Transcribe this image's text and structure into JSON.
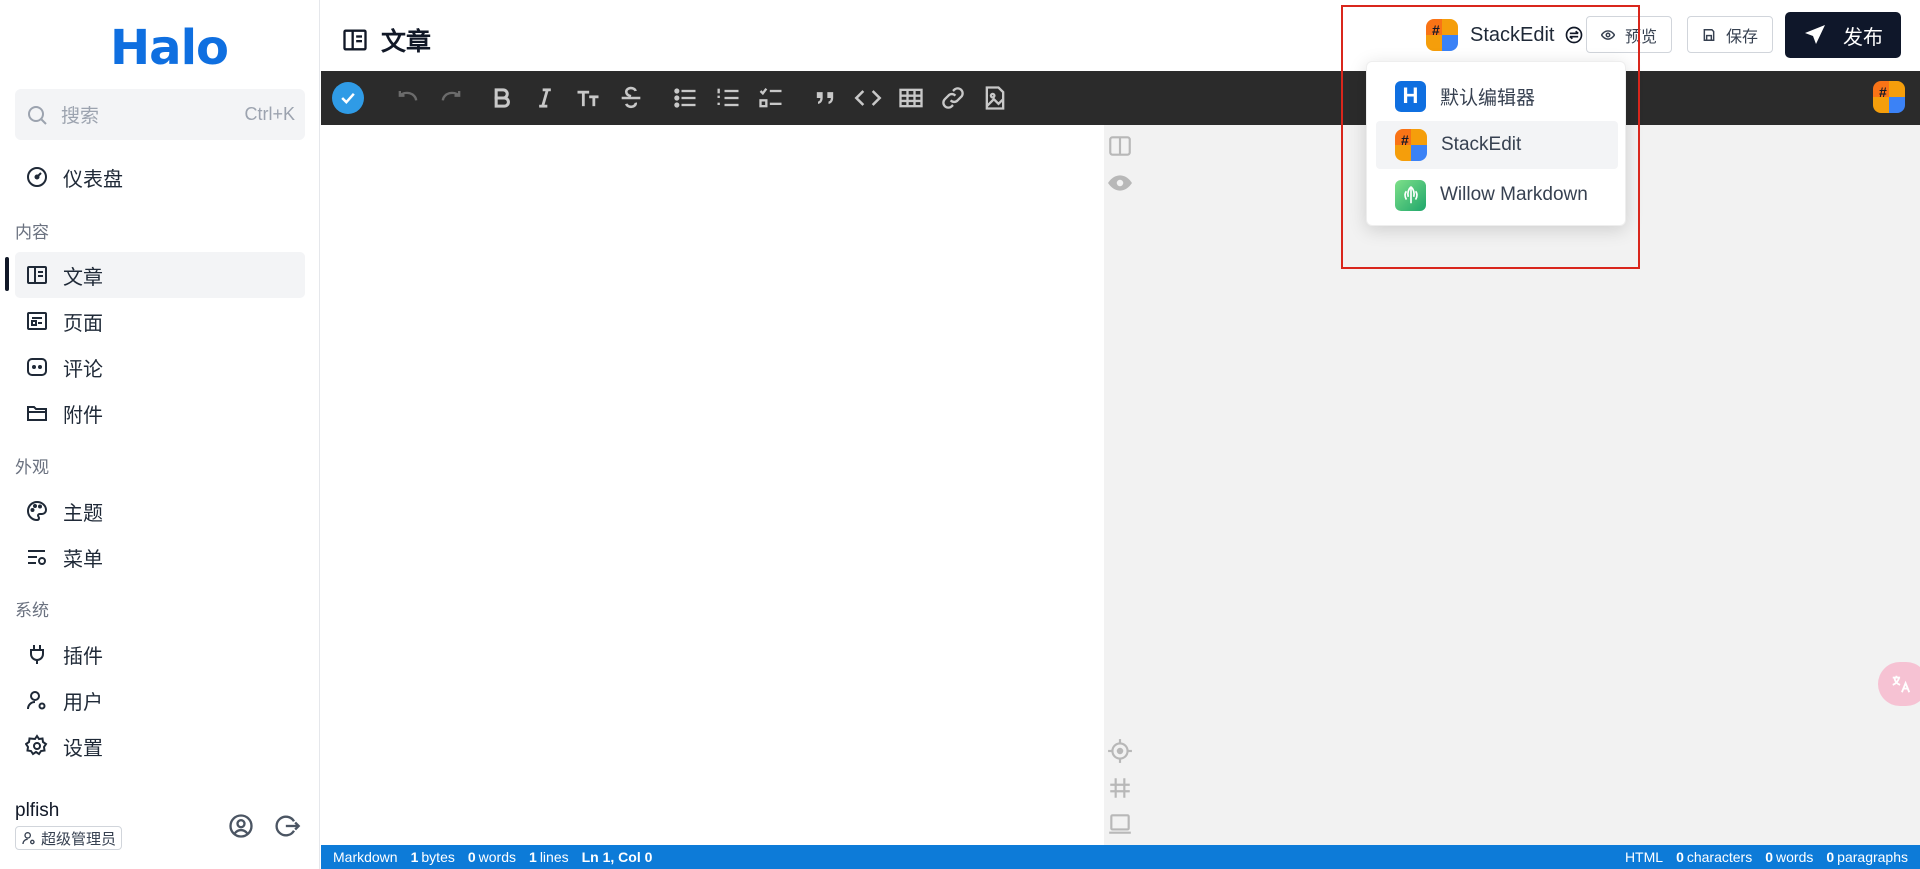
{
  "sidebar": {
    "logo": "Halo",
    "search": {
      "placeholder": "搜索",
      "shortcut": "Ctrl+K"
    },
    "dashboard": "仪表盘",
    "sections": {
      "content": "内容",
      "appearance": "外观",
      "system": "系统"
    },
    "items": {
      "posts": "文章",
      "pages": "页面",
      "comments": "评论",
      "attachments": "附件",
      "themes": "主题",
      "menus": "菜单",
      "plugins": "插件",
      "users": "用户",
      "settings": "设置"
    },
    "user": {
      "name": "plfish",
      "role": "超级管理员"
    }
  },
  "header": {
    "title": "文章",
    "editor_selected": "StackEdit",
    "preview_label": "预览",
    "save_label": "保存",
    "publish_label": "发布"
  },
  "editor_dropdown": {
    "options": [
      {
        "label": "默认编辑器",
        "icon": "halo-h-icon"
      },
      {
        "label": "StackEdit",
        "icon": "stackedit-icon"
      },
      {
        "label": "Willow Markdown",
        "icon": "willow-icon"
      }
    ],
    "selected_index": 1
  },
  "status_bar": {
    "mode": "Markdown",
    "bytes": "1",
    "bytes_label": "bytes",
    "words": "0",
    "words_label": "words",
    "lines": "1",
    "lines_label": "lines",
    "position": "Ln 1, Col 0",
    "right_mode": "HTML",
    "characters": "0",
    "characters_label": "characters",
    "right_words": "0",
    "right_words_label": "words",
    "paragraphs": "0",
    "paragraphs_label": "paragraphs"
  },
  "colors": {
    "brand": "#0f6fe0",
    "toolbar_bg": "#2b2b2b",
    "status_bg": "#0d7bd8",
    "publish_bg": "#0f172a",
    "highlight": "#d9261c"
  }
}
